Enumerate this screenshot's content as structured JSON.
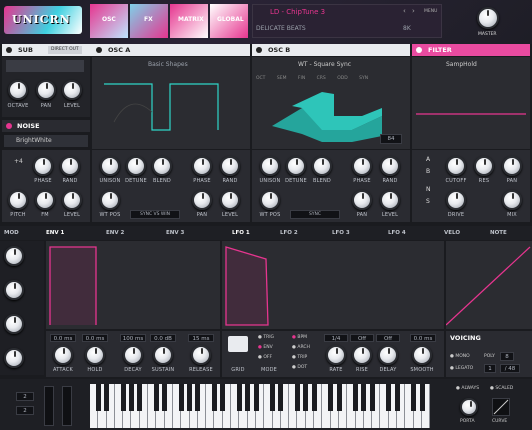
{
  "logo": "UNICRN",
  "top_tabs": [
    "OSC",
    "FX",
    "MATRIX",
    "GLOBAL"
  ],
  "preset": {
    "name": "LD - ChipTune 3",
    "bank": "DELICATE BEATS",
    "size": "8K",
    "menu": "MENU"
  },
  "master_label": "MASTER",
  "sub": {
    "title": "SUB",
    "mode": "DIRECT OUT",
    "knobs": [
      "OCTAVE",
      "PAN",
      "LEVEL"
    ]
  },
  "noise": {
    "title": "NOISE",
    "type": "BrightWhite"
  },
  "osc_a": {
    "title": "OSC A",
    "wave": "Basic Shapes",
    "knobs_top": [
      "PHASE",
      "RAND"
    ],
    "oct": "+4",
    "knobs_bottom": [
      "PITCH",
      "FM",
      "LEVEL"
    ],
    "uni_knobs": [
      "UNISON",
      "DETUNE",
      "BLEND"
    ],
    "osc_knobs": [
      "PHASE",
      "RAND"
    ],
    "bottom": [
      "WT POS"
    ],
    "bottom_btn": "SYNC VS WIN",
    "bottom_knobs": [
      "PAN",
      "LEVEL"
    ]
  },
  "osc_b": {
    "title": "OSC B",
    "wave": "WT - Square Sync",
    "params": [
      "OCT",
      "SEM",
      "FIN",
      "CRS",
      "ODD",
      "SYN"
    ],
    "frame": "84",
    "uni_knobs": [
      "UNISON",
      "DETUNE",
      "BLEND"
    ],
    "osc_knobs": [
      "PHASE",
      "RAND"
    ],
    "bottom": [
      "WT POS"
    ],
    "bottom_btn": "SYNC",
    "bottom_knobs": [
      "PAN",
      "LEVEL"
    ]
  },
  "filter": {
    "title": "FILTER",
    "type": "SampHold",
    "routes": [
      "A",
      "B",
      "N",
      "S"
    ],
    "knobs": [
      "CUTOFF",
      "RES",
      "PAN"
    ],
    "knobs2": [
      "DRIVE",
      "MIX"
    ]
  },
  "mod_tabs": [
    "MOD",
    "ENV 1",
    "ENV 2",
    "ENV 3",
    "LFO 1",
    "LFO 2",
    "LFO 3",
    "LFO 4",
    "VELO",
    "NOTE"
  ],
  "env": {
    "values": [
      "0.0 ms",
      "0.0 ms",
      "100 ms",
      "0.0 dB",
      "15 ms"
    ],
    "knobs": [
      "ATTACK",
      "HOLD",
      "DECAY",
      "SUSTAIN",
      "RELEASE"
    ]
  },
  "lfo": {
    "modes": [
      "TRIG",
      "ENV",
      "OFF"
    ],
    "modes2": [
      "BPM",
      "ARCH",
      "TRIP",
      "DOT"
    ],
    "grid_label": "GRID",
    "mode_label": "MODE",
    "values": [
      "1/4",
      "Off",
      "Off",
      "0.0 ms"
    ],
    "knobs": [
      "RATE",
      "RISE",
      "DELAY",
      "SMOOTH"
    ]
  },
  "voicing": {
    "title": "VOICING",
    "mono": "MONO",
    "legato": "LEGATO",
    "poly_label": "POLY",
    "poly": "8",
    "poly2": "1",
    "poly3": "/ 48"
  },
  "bottom": {
    "always": "ALWAYS",
    "scaled": "SCALED",
    "porta": "PORTA",
    "curve": "CURVE",
    "pb1": "2",
    "pb2": "2"
  },
  "colors": {
    "accent": "#e6358f",
    "teal": "#2fd6c8"
  }
}
